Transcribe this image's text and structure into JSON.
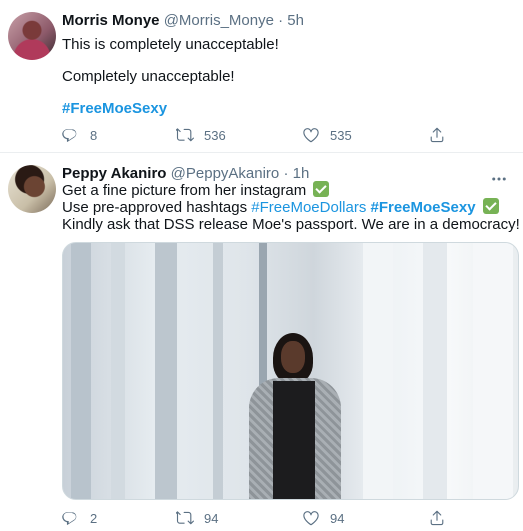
{
  "tweets": [
    {
      "name": "Morris Monye",
      "handle": "@Morris_Monye",
      "separator": "·",
      "time": "5h",
      "lines": [
        "This is completely unacceptable!",
        "Completely unacceptable!"
      ],
      "hashtag": "#FreeMoeSexy",
      "replies": "8",
      "retweets": "536",
      "likes": "535"
    },
    {
      "name": "Peppy Akaniro",
      "handle": "@PeppyAkaniro",
      "separator": "·",
      "time": "1h",
      "line1": "Get a fine picture from her instagram",
      "line2_prefix": "Use pre-approved hashtags ",
      "line2_tag1": "#FreeMoeDollars",
      "line2_tag2": "#FreeMoeSexy",
      "line3": "Kindly ask that DSS release Moe's passport. We are in a democracy!",
      "replies": "2",
      "retweets": "94",
      "likes": "94"
    }
  ],
  "icons": {
    "reply": "reply-icon",
    "retweet": "retweet-icon",
    "like": "heart-icon",
    "share": "share-icon",
    "more": "more-icon",
    "check": "check-mark-icon"
  },
  "colors": {
    "accent": "#1b95e0",
    "muted": "#5b7083",
    "check": "#77b255"
  }
}
